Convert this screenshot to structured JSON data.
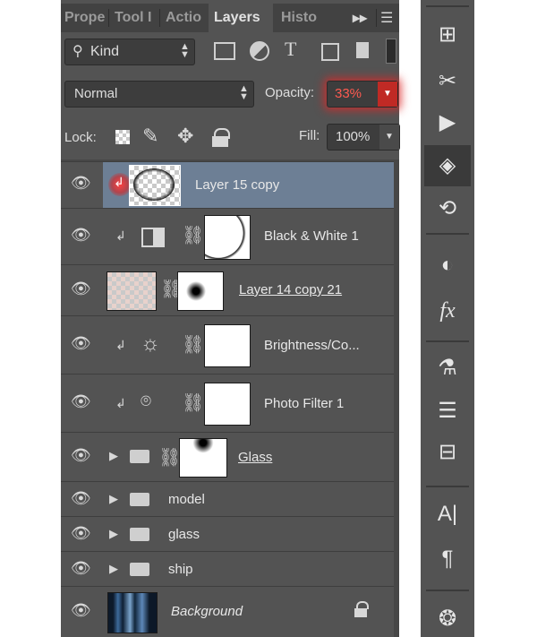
{
  "tabs": [
    {
      "label": "Prope"
    },
    {
      "label": "Tool I"
    },
    {
      "label": "Actio"
    },
    {
      "label": "Layers"
    },
    {
      "label": "Histo"
    }
  ],
  "filter": {
    "label": "Kind"
  },
  "blend": {
    "mode": "Normal",
    "opacity_label": "Opacity:",
    "opacity_value": "33%"
  },
  "lock": {
    "label": "Lock:",
    "fill_label": "Fill:",
    "fill_value": "100%"
  },
  "layers": [
    {
      "name": "Layer 15 copy",
      "selected": true
    },
    {
      "name": "Black & White 1"
    },
    {
      "name": "Layer 14 copy 21"
    },
    {
      "name": "Brightness/Co..."
    },
    {
      "name": "Photo Filter 1"
    },
    {
      "name": "Glass"
    },
    {
      "name": "model"
    },
    {
      "name": "glass"
    },
    {
      "name": "ship"
    },
    {
      "name": "Background"
    }
  ],
  "colors": {
    "panel": "#535353",
    "selected_row": "#6d7f95",
    "opacity_highlight": "#d9302b"
  },
  "icons": {
    "rightbar": [
      "info-panel-icon",
      "tools-icon",
      "play-icon",
      "layers-icon",
      "history-icon",
      "adjustments-icon",
      "styles-icon",
      "brush-presets-icon",
      "brush-icon",
      "clone-source-icon",
      "character-icon",
      "paragraph-icon",
      "channels-icon"
    ]
  }
}
